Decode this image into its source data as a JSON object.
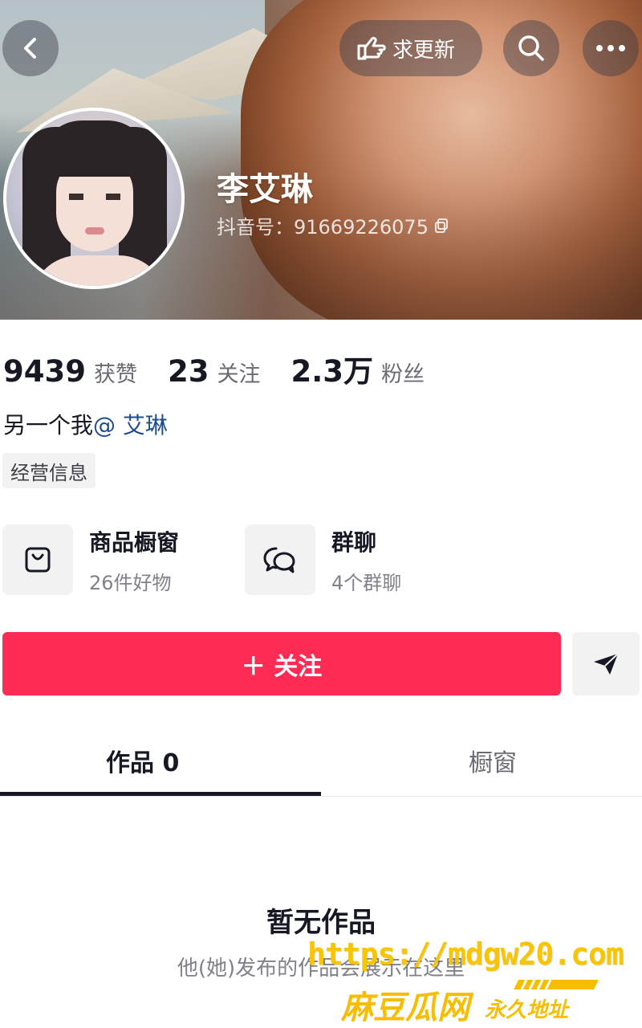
{
  "header": {
    "update_label": "求更新",
    "icons": {
      "back": "chevron-left-icon",
      "update": "hand-pointer-icon",
      "search": "search-icon",
      "more": "more-dots-icon"
    }
  },
  "profile": {
    "name": "李艾琳",
    "douyin_id": "抖音号：91669226075"
  },
  "stats": [
    {
      "num": "9439",
      "label": "获赞"
    },
    {
      "num": "23",
      "label": "关注"
    },
    {
      "num": "2.3万",
      "label": "粉丝"
    }
  ],
  "bio": {
    "text": "另一个我",
    "mention": "@ 艾琳"
  },
  "biz_tag": "经营信息",
  "features": {
    "shop": {
      "title": "商品橱窗",
      "sub": "26件好物",
      "icon": "shopping-bag-icon"
    },
    "group": {
      "title": "群聊",
      "sub": "4个群聊",
      "icon": "chat-bubbles-icon"
    }
  },
  "actions": {
    "follow_label": "＋ 关注",
    "share_icon": "send-icon"
  },
  "tabs": [
    {
      "label": "作品 0"
    },
    {
      "label": "橱窗"
    }
  ],
  "empty": {
    "title": "暂无作品",
    "sub": "他(她)发布的作品会展示在这里"
  },
  "watermark": {
    "url": "https://mdgw20.com",
    "name": "麻豆瓜网",
    "forever": "永久地址"
  },
  "colors": {
    "accent": "#fe2c55",
    "mention": "#1f4d8a",
    "watermark": "#f9c400"
  }
}
